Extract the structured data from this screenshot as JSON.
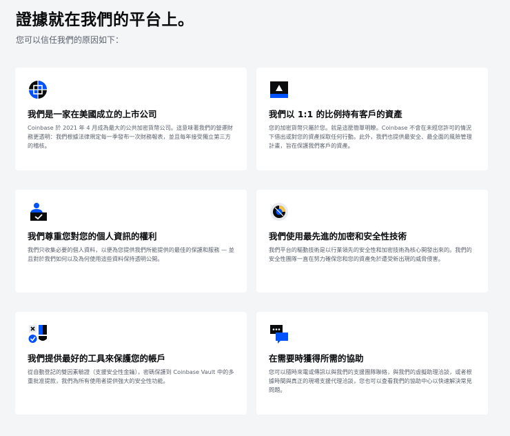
{
  "header": {
    "title": "證據就在我們的平台上。",
    "subtitle": "您可以信任我們的原因如下："
  },
  "colors": {
    "brand_blue": "#0052ff",
    "navy": "#0a0b0d",
    "background": "#f4f5f7",
    "card": "#ffffff",
    "muted_text": "#5b616e"
  },
  "cards": [
    {
      "icon": "public-company-globe-icon",
      "title": "我們是一家在美國成立的上市公司",
      "description": "Coinbase 於 2021 年 4 月成為最大的公共加密貨幣公司。這意味著我們的營運財務更透明：我們根據法律規定每一季發布一次財務報表，並且每年接受獨立第三方的稽核。"
    },
    {
      "icon": "vault-assets-icon",
      "title": "我們以 1:1 的比例持有客戶的資產",
      "description": "您的加密貨幣只屬於您。就是這麼簡單明瞭。Coinbase 不會在未經您許可的情況下借出或對您的資產採取任何行動。此外，我們也提供最安全、最全面的風險管理計畫，旨在保護我們客戶的資產。"
    },
    {
      "icon": "user-privacy-icon",
      "title": "我們尊重您對您的個人資訊的權利",
      "description": "我們只收集必要的個人資料，以便為您提供我們所能提供的最佳的保護和服務 — 並且對於我們如何以及為何使用這些資料保持透明公開。"
    },
    {
      "icon": "encryption-security-icon",
      "title": "我們使用最先進的加密和安全性技術",
      "description": "我們平台的驅動技術是以行業領先的安全性和加密技術為核心開發出來的。我們的安全性團隊一直在努力確保您和您的資產免於遭受新出現的威脅侵害。"
    },
    {
      "icon": "account-protection-tools-icon",
      "title": "我們提供最好的工具來保護您的帳戶",
      "description": "從自動登記的雙因素驗證（支援安全性金鑰），密碼保護到 Coinbase Vault 中的多重批准提款，我們為所有使用者提供強大的安全性功能。"
    },
    {
      "icon": "support-chat-icon",
      "title": "在需要時獲得所需的協助",
      "description": "您可以隨時來電或傳訊以與我們的支援團隊聯絡，與我們的虛擬助理洽談，或者根據時間與真正的現場支援代理洽談，您也可以查看我們的協助中心以快速解決常見問題。"
    }
  ]
}
